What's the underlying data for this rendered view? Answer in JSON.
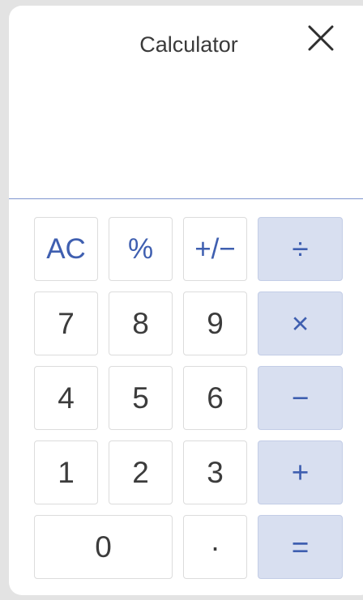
{
  "window": {
    "title": "Calculator",
    "close_icon": "close-icon"
  },
  "display": {
    "value": ""
  },
  "colors": {
    "accent": "#3f5fb0",
    "operator_bg": "#d8dff0",
    "divider": "#7e95cf"
  },
  "keys": {
    "clear": "AC",
    "percent": "%",
    "sign": "+/−",
    "divide": "÷",
    "seven": "7",
    "eight": "8",
    "nine": "9",
    "multiply": "×",
    "four": "4",
    "five": "5",
    "six": "6",
    "subtract": "−",
    "one": "1",
    "two": "2",
    "three": "3",
    "add": "+",
    "zero": "0",
    "decimal": "·",
    "equals": "="
  }
}
